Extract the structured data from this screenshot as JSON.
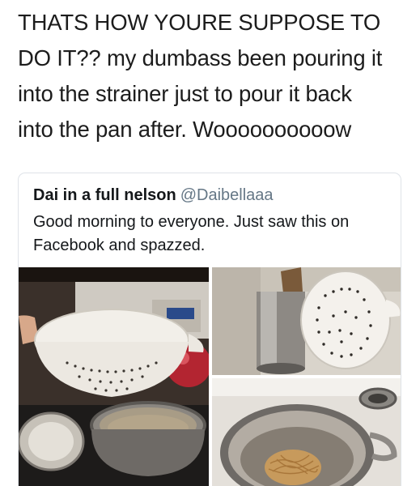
{
  "tweet": {
    "lines": [
      "THATS HOW YOURE SUPPOSE TO",
      "DO IT?? my dumbass been pouring it",
      "into the strainer just to pour it back",
      "into the pan after. Woooooooooow"
    ]
  },
  "quoted_tweet": {
    "name": "Dai in a full nelson",
    "handle": "@Daibellaaa",
    "text_lines": [
      "Good morning to everyone. Just saw this on",
      "Facebook and spazzed."
    ]
  },
  "media": [
    {
      "name": "photo-colander-over-pot"
    },
    {
      "name": "photo-pot-with-colander-lid"
    },
    {
      "name": "photo-drained-spaghetti-in-pot"
    }
  ]
}
